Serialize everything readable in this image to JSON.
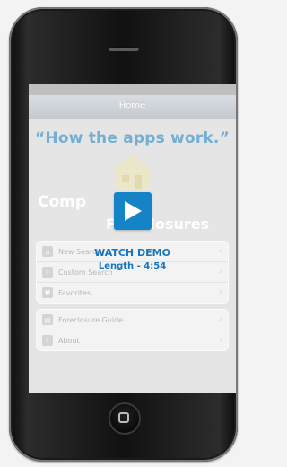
{
  "screen": {
    "nav_title": "Home",
    "hero_title": "“How the apps work.”",
    "app_title": "Comp",
    "app_subtitle": "Foreclosures",
    "menu_groups": [
      [
        {
          "label": "New Search",
          "icon": "home-icon"
        },
        {
          "label": "Custom Search",
          "icon": "search-icon"
        },
        {
          "label": "Favorites",
          "icon": "heart-icon"
        }
      ],
      [
        {
          "label": "Foreclosure Guide",
          "icon": "book-icon"
        },
        {
          "label": "About",
          "icon": "question-icon"
        }
      ]
    ]
  },
  "video": {
    "cta": "WATCH DEMO",
    "length": "Length - 4:54"
  },
  "colors": {
    "accent_blue": "#1584c6",
    "title_blue": "#2a84b8"
  }
}
